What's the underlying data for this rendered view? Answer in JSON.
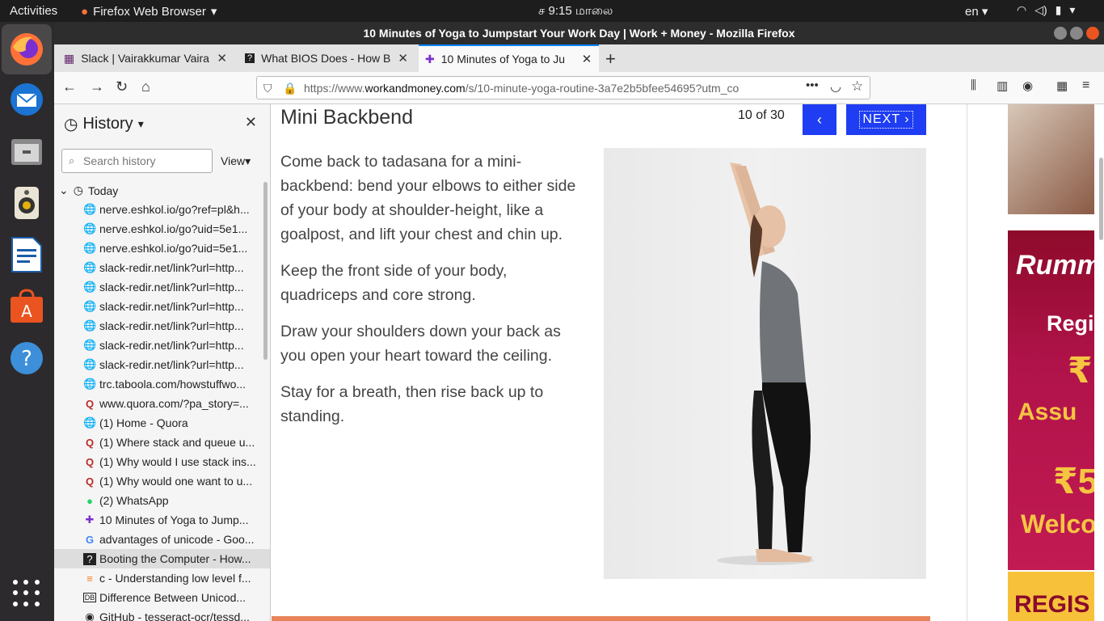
{
  "topbar": {
    "activities": "Activities",
    "app_name": "Firefox Web Browser",
    "clock": "ச 9:15 மாலை",
    "lang": "en"
  },
  "window": {
    "title": "10 Minutes of Yoga to Jumpstart Your Work Day | Work + Money - Mozilla Firefox"
  },
  "tabs": [
    {
      "label": "Slack | Vairakkumar Vaira",
      "icon": "slack-icon"
    },
    {
      "label": "What BIOS Does - How B",
      "icon": "howstuffworks-icon"
    },
    {
      "label": "10 Minutes of Yoga to Ju",
      "icon": "workandmoney-icon"
    }
  ],
  "urlbar": {
    "prefix": "https://www.",
    "domain": "workandmoney.com",
    "path": "/s/10-minute-yoga-routine-3a7e2b5bfee54695?utm_co"
  },
  "sidebar": {
    "title": "History",
    "search_placeholder": "Search history",
    "view_label": "View",
    "group_today": "Today",
    "items": [
      {
        "label": "nerve.eshkol.io/go?ref=pl&h...",
        "icon": "globe"
      },
      {
        "label": "nerve.eshkol.io/go?uid=5e1...",
        "icon": "globe"
      },
      {
        "label": "nerve.eshkol.io/go?uid=5e1...",
        "icon": "globe"
      },
      {
        "label": "slack-redir.net/link?url=http...",
        "icon": "globe"
      },
      {
        "label": "slack-redir.net/link?url=http...",
        "icon": "globe"
      },
      {
        "label": "slack-redir.net/link?url=http...",
        "icon": "globe"
      },
      {
        "label": "slack-redir.net/link?url=http...",
        "icon": "globe"
      },
      {
        "label": "slack-redir.net/link?url=http...",
        "icon": "globe"
      },
      {
        "label": "slack-redir.net/link?url=http...",
        "icon": "globe"
      },
      {
        "label": "trc.taboola.com/howstuffwo...",
        "icon": "globe"
      },
      {
        "label": "www.quora.com/?pa_story=...",
        "icon": "quora"
      },
      {
        "label": "(1) Home - Quora",
        "icon": "globe"
      },
      {
        "label": "(1) Where stack and queue u...",
        "icon": "quora"
      },
      {
        "label": "(1) Why would I use stack ins...",
        "icon": "quora"
      },
      {
        "label": "(1) Why would one want to u...",
        "icon": "quora"
      },
      {
        "label": "(2) WhatsApp",
        "icon": "whatsapp"
      },
      {
        "label": "10 Minutes of Yoga to Jump...",
        "icon": "workandmoney"
      },
      {
        "label": "advantages of unicode - Goo...",
        "icon": "google"
      },
      {
        "label": "Booting the Computer - How...",
        "icon": "howstuffworks"
      },
      {
        "label": "c - Understanding low level f...",
        "icon": "stackoverflow"
      },
      {
        "label": "Difference Between Unicod...",
        "icon": "db"
      },
      {
        "label": "GitHub - tesseract-ocr/tessd...",
        "icon": "github"
      }
    ]
  },
  "slide": {
    "title": "Mini Backbend",
    "counter": "10 of 30",
    "prev_label": "‹",
    "next_label": "NEXT ›",
    "paragraphs": [
      "Come back to tadasana for a mini-backbend: bend your elbows to either side of your body at shoulder-height, like a goalpost, and lift your chest and chin up.",
      "Keep the front side of your body, quadriceps and core strong.",
      "Draw your shoulders down your back as you open your heart toward the ceiling.",
      "Stay for a breath, then rise back up to standing."
    ]
  },
  "ads": {
    "rummy_logo": "Rumm",
    "rummy_regi": "Regi",
    "rummy_rs1": "₹",
    "rummy_assu": "Assu",
    "rummy_rs2": "₹5",
    "rummy_welc": "Welco",
    "rummy_regis": "REGIS"
  }
}
